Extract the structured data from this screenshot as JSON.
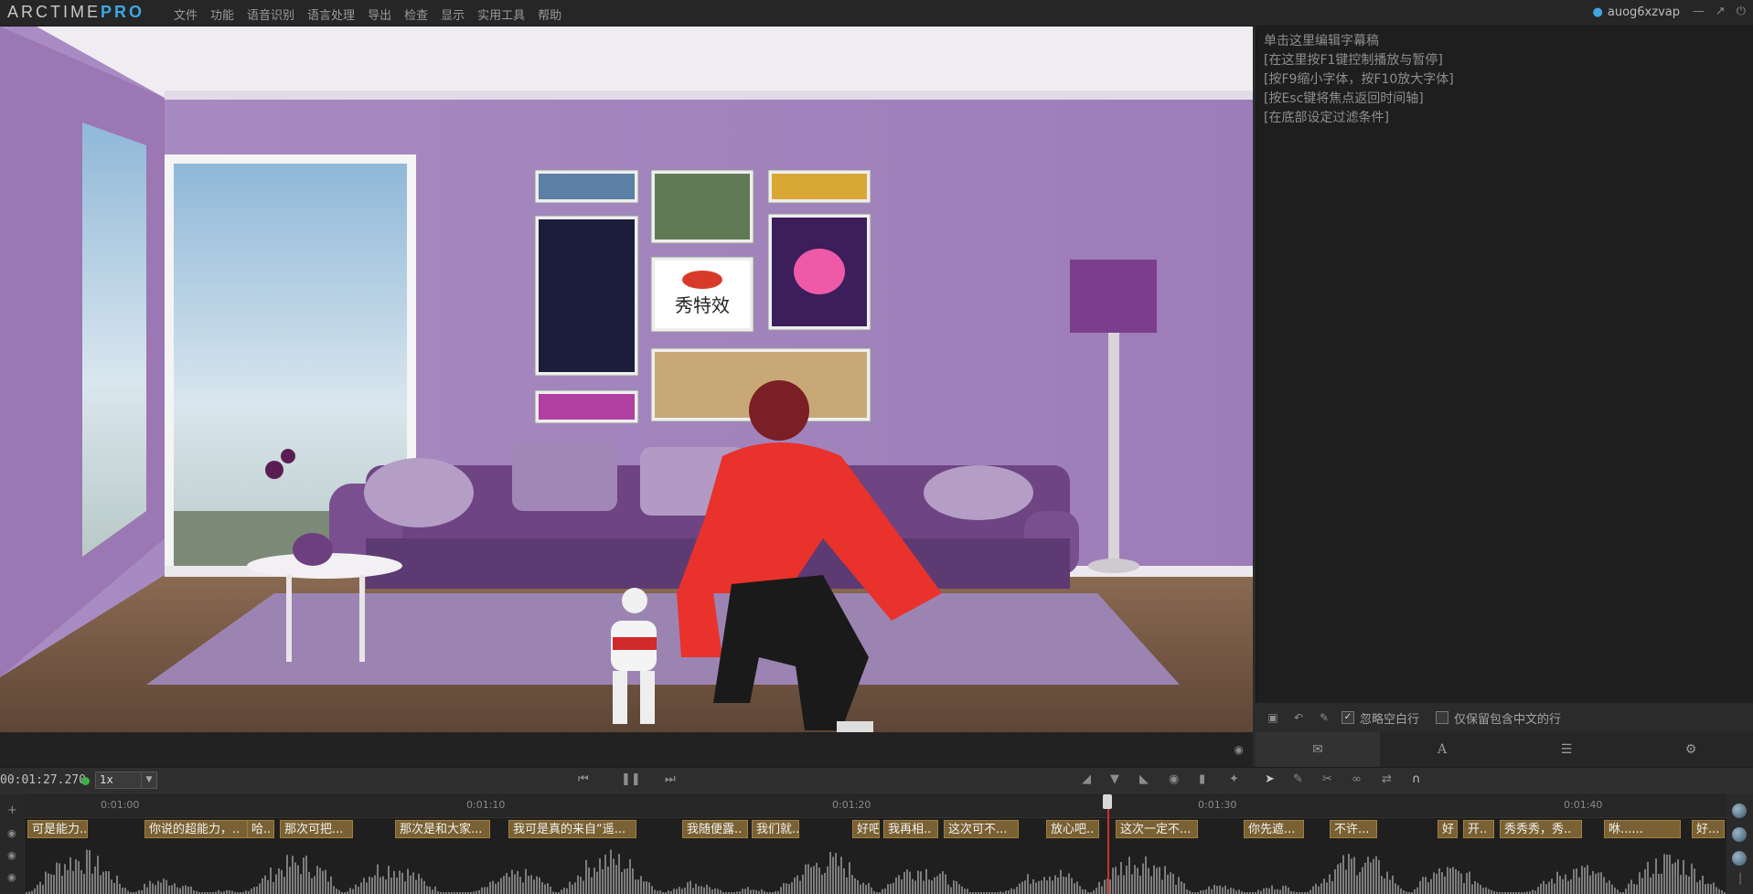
{
  "app": {
    "logo_main": "ARCTIME",
    "logo_pro": "PRO"
  },
  "menu": [
    "文件",
    "功能",
    "语音识别",
    "语言处理",
    "导出",
    "检查",
    "显示",
    "实用工具",
    "帮助"
  ],
  "user": {
    "name": "auog6xzvap",
    "icon": "user-icon"
  },
  "window_controls": [
    "minimize-icon",
    "maximize-icon",
    "power-icon"
  ],
  "video": {
    "logo_text": "秀特效"
  },
  "editor": {
    "hints": [
      "单击这里编辑字幕稿",
      "[在这里按F1键控制播放与暂停]",
      "[按F9缩小字体，按F10放大字体]",
      "[按Esc键将焦点返回时间轴]",
      "[在底部设定过滤条件]"
    ]
  },
  "filter": {
    "ignore_blank_label": "忽略空白行",
    "ignore_blank_checked": true,
    "keep_chinese_label": "仅保留包含中文的行",
    "keep_chinese_checked": false
  },
  "tabs": [
    "comment-icon",
    "font-icon",
    "list-icon",
    "gear-icon"
  ],
  "transport": {
    "timecode": "00:01:27.270",
    "speed": "1x"
  },
  "timeline": {
    "ticks": [
      "0:01:00",
      "0:01:10",
      "0:01:20",
      "0:01:30",
      "0:01:40"
    ],
    "subtitles": [
      "可是能力..",
      "你说的超能力，..",
      "哈..",
      "那次可把...",
      "那次是和大家...",
      "我可是真的来自“遥...",
      "我随便露..",
      "我们就..",
      "好吧",
      "我再相..",
      "这次可不...",
      "放心吧..",
      "这次一定不...",
      "你先遮...",
      "不许...",
      "好",
      "开..",
      "秀秀秀，秀..",
      "咻......",
      "好..."
    ]
  }
}
